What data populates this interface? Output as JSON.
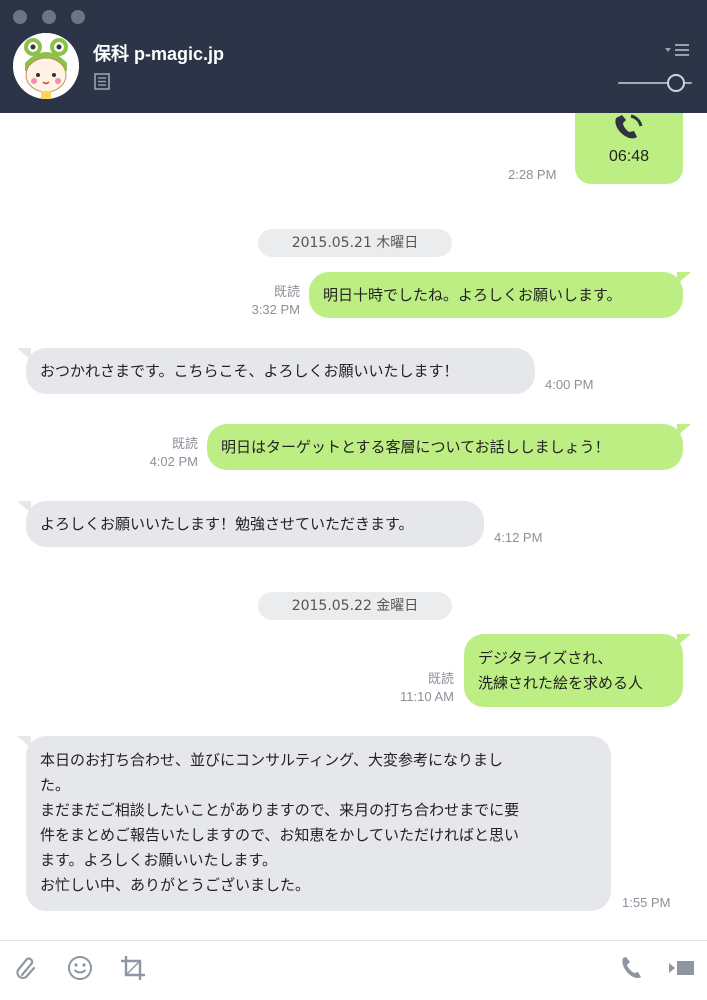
{
  "window": {
    "controls": [
      "close",
      "minimize",
      "zoom"
    ]
  },
  "header": {
    "title": "保科 p-magic.jp",
    "avatar_icon": "frog-hat-character-avatar",
    "note_icon": "note-icon",
    "menu_icon": "menu-icon",
    "volume_level": 0.88
  },
  "call": {
    "duration": "06:48",
    "time": "2:28 PM"
  },
  "dates": [
    "2015.05.21 木曜日",
    "2015.05.22 金曜日"
  ],
  "messages": [
    {
      "side": "me",
      "read": "既読",
      "time": "3:32 PM",
      "lines": [
        "明日十時でしたね。よろしくお願いします。"
      ]
    },
    {
      "side": "them",
      "time": "4:00 PM",
      "lines": [
        "おつかれさまです。こちらこそ、よろしくお願いいたします！"
      ]
    },
    {
      "side": "me",
      "read": "既読",
      "time": "4:02 PM",
      "lines": [
        "明日はターゲットとする客層についてお話ししましょう！"
      ]
    },
    {
      "side": "them",
      "time": "4:12 PM",
      "lines": [
        "よろしくお願いいたします！勉強させていただきます。"
      ]
    },
    {
      "side": "me",
      "read": "既読",
      "time": "11:10 AM",
      "lines": [
        "デジタライズされ、",
        "洗練された絵を求める人"
      ]
    },
    {
      "side": "them",
      "time": "1:55 PM",
      "lines": [
        "本日のお打ち合わせ、並びにコンサルティング、大変参考になりまし",
        "た。",
        "まだまだご相談したいことがありますので、来月の打ち合わせまでに要",
        "件をまとめご報告いたしますので、お知恵をかしていただければと思い",
        "ます。よろしくお願いいたします。",
        "お忙しい中、ありがとうございました。"
      ]
    }
  ],
  "toolbar": {
    "icons": [
      "attach-icon",
      "emoji-icon",
      "crop-icon",
      "phone-icon",
      "video-icon"
    ]
  },
  "colors": {
    "header_bg": "#2c3447",
    "my_bubble": "#bdee83",
    "their_bubble": "#e6e7ea"
  }
}
